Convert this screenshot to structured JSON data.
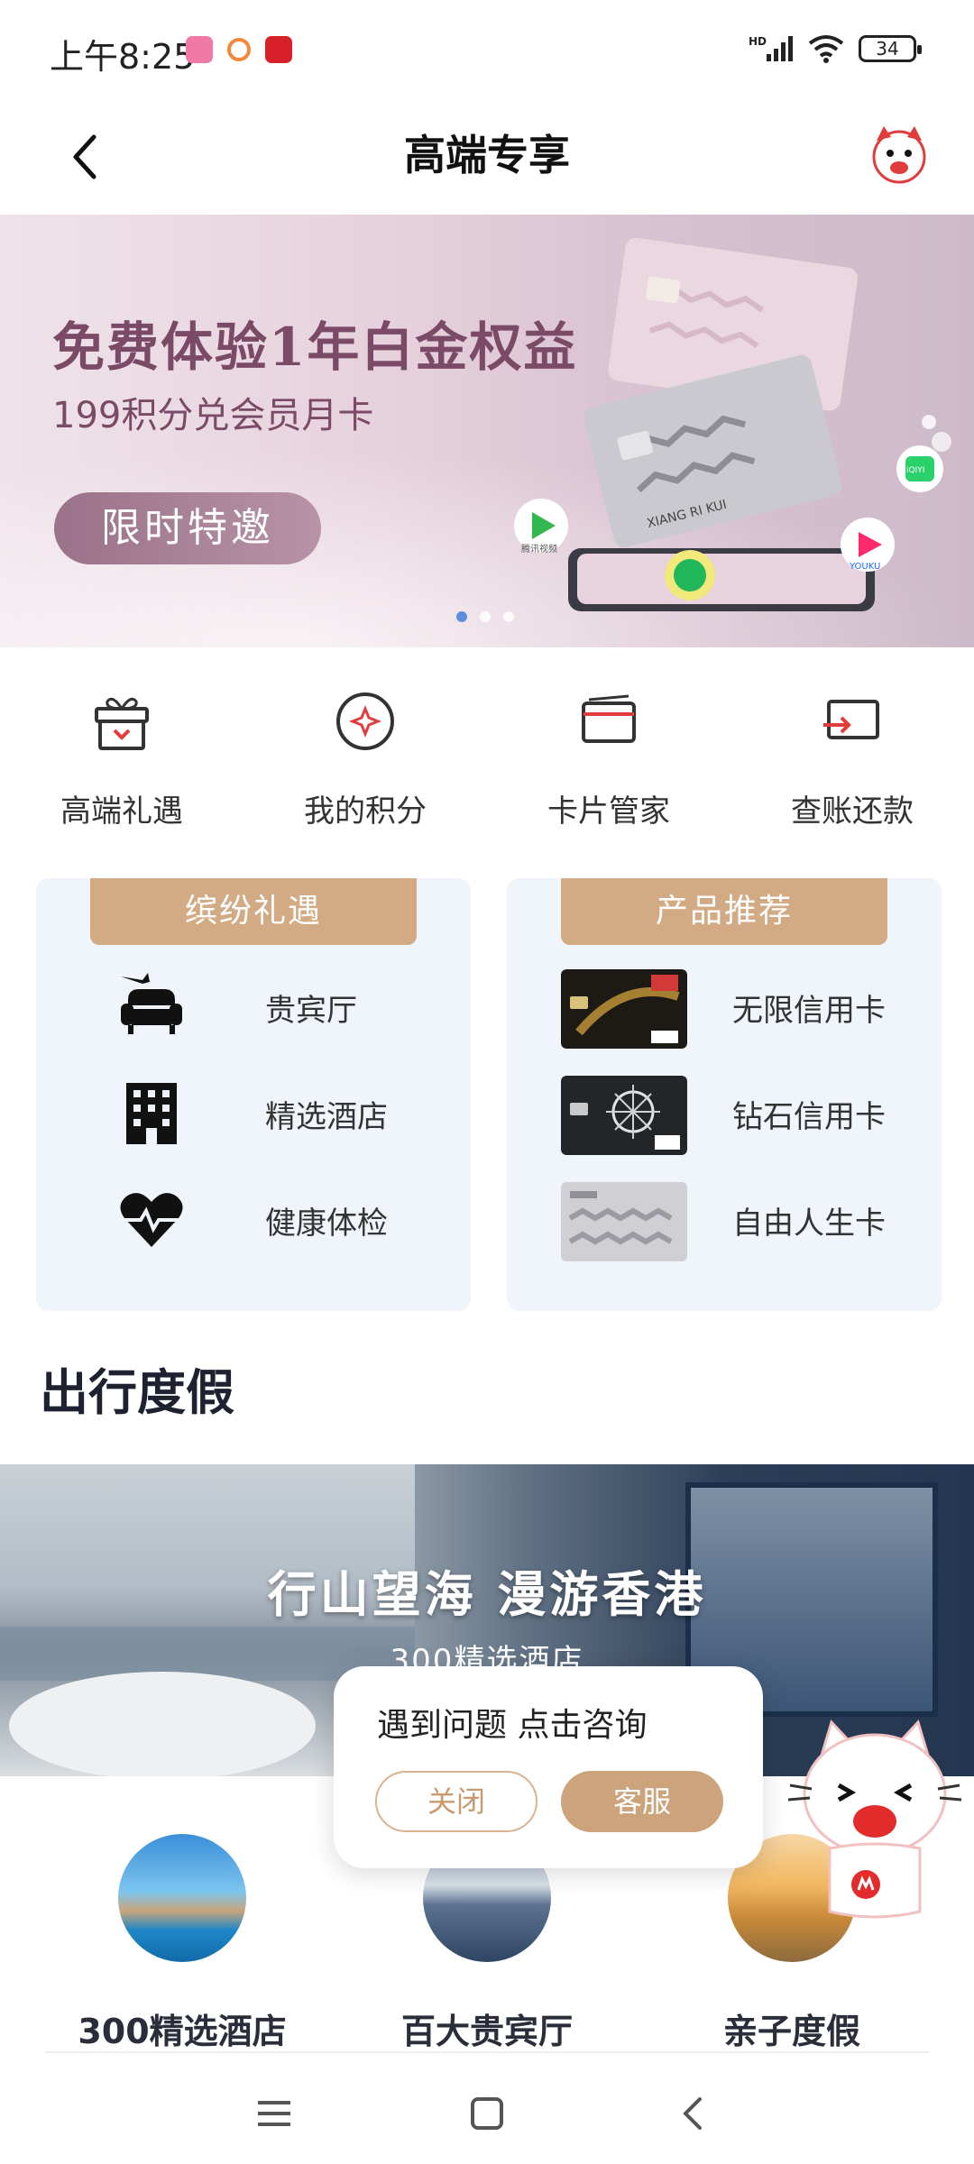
{
  "status_bar": {
    "time": "上午8:25",
    "signal_label": "HD",
    "battery": "34"
  },
  "nav": {
    "title": "高端专享"
  },
  "banner": {
    "title": "免费体验1年白金权益",
    "subtitle": "199积分兑会员月卡",
    "button": "限时特邀",
    "card_label": "XIANG RI KUI",
    "app_labels": [
      "腾讯视频",
      "iQIYI",
      "YOUKU"
    ]
  },
  "quick_actions": [
    {
      "label": "高端礼遇",
      "icon": "gift-icon"
    },
    {
      "label": "我的积分",
      "icon": "points-icon"
    },
    {
      "label": "卡片管家",
      "icon": "card-wallet-icon"
    },
    {
      "label": "查账还款",
      "icon": "bill-repay-icon"
    }
  ],
  "panels": {
    "left": {
      "title": "缤纷礼遇",
      "items": [
        {
          "label": "贵宾厅",
          "icon": "lounge-icon"
        },
        {
          "label": "精选酒店",
          "icon": "hotel-icon"
        },
        {
          "label": "健康体检",
          "icon": "health-check-icon"
        }
      ]
    },
    "right": {
      "title": "产品推荐",
      "items": [
        {
          "label": "无限信用卡"
        },
        {
          "label": "钻石信用卡"
        },
        {
          "label": "自由人生卡"
        }
      ]
    }
  },
  "section": {
    "title": "出行度假",
    "banner_title": "行山望海 漫游香港",
    "banner_sub": "300精选酒店"
  },
  "circles": [
    {
      "label": "300精选酒店"
    },
    {
      "label": "百大贵宾厅"
    },
    {
      "label": "亲子度假"
    }
  ],
  "popup": {
    "text": "遇到问题 点击咨询",
    "close": "关闭",
    "service": "客服"
  },
  "colors": {
    "gold": "#d2ab84",
    "panel_bg": "#f0f4fb",
    "banner_text": "#7a4a66"
  }
}
